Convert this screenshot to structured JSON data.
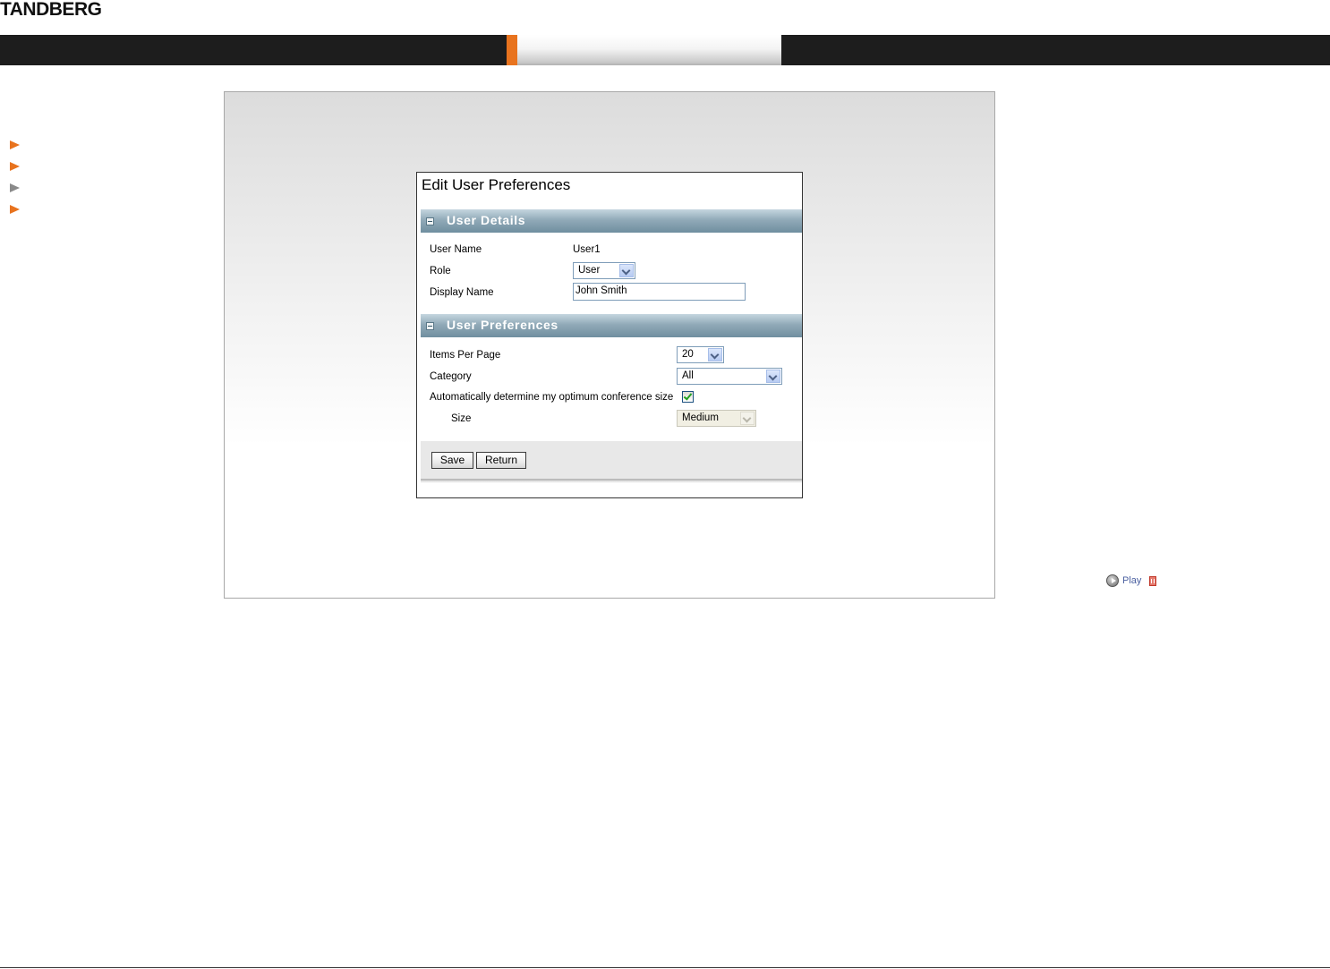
{
  "brand": {
    "logo_text": "TANDBERG",
    "accent_color": "#e8731e"
  },
  "sidebar": {
    "items": [
      {
        "icon": "arrow-right-icon",
        "color": "#e8731e"
      },
      {
        "icon": "arrow-right-icon",
        "color": "#e8731e"
      },
      {
        "icon": "arrow-right-icon",
        "color": "#8a8a8a"
      },
      {
        "icon": "arrow-right-icon",
        "color": "#e8731e"
      }
    ]
  },
  "dialog": {
    "title": "Edit User Preferences",
    "user_details": {
      "heading": "User Details",
      "user_name_label": "User Name",
      "user_name_value": "User1",
      "role_label": "Role",
      "role_value": "User",
      "display_name_label": "Display Name",
      "display_name_value": "John Smith"
    },
    "user_preferences": {
      "heading": "User Preferences",
      "items_per_page_label": "Items Per Page",
      "items_per_page_value": "20",
      "category_label": "Category",
      "category_value": "All",
      "auto_size_label": "Automatically determine my optimum conference size",
      "auto_size_checked": true,
      "size_label": "Size",
      "size_value": "Medium"
    },
    "buttons": {
      "save": "Save",
      "return": "Return"
    }
  },
  "player": {
    "play_label": "Play"
  }
}
